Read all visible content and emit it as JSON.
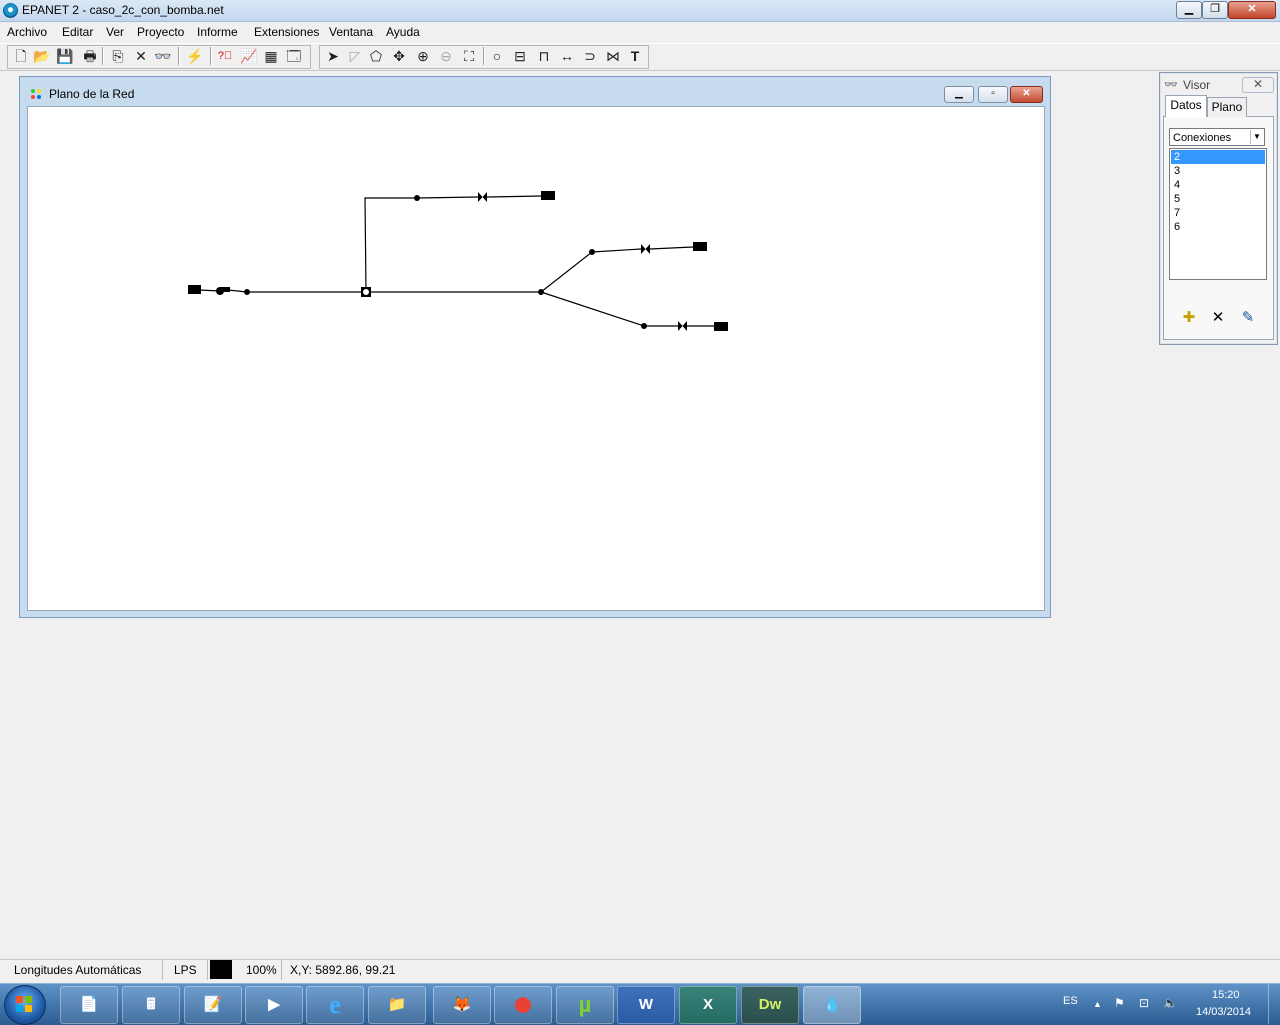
{
  "app": {
    "title": "EPANET 2 - caso_2c_con_bomba.net",
    "window_buttons": {
      "minimize": "▁",
      "maximize": "❐",
      "close": "✕"
    }
  },
  "menu": [
    "Archivo",
    "Editar",
    "Ver",
    "Proyecto",
    "Informe",
    "Extensiones",
    "Ventana",
    "Ayuda"
  ],
  "toolbar": {
    "icons": [
      "new-icon",
      "open-icon",
      "save-icon",
      "print-icon",
      "copy-icon",
      "delete-icon",
      "find-icon",
      "run-icon",
      "query-icon",
      "graph-icon",
      "table-icon",
      "options-icon",
      "select-icon",
      "select-vertex-icon",
      "select-region-icon",
      "pan-icon",
      "zoom-in-icon",
      "zoom-out-icon",
      "full-extent-icon",
      "add-junction-icon",
      "add-reservoir-icon",
      "add-tank-icon",
      "add-pipe-icon",
      "add-pump-icon",
      "add-valve-icon",
      "add-label-icon"
    ],
    "glyphs": {
      "new": "🗋",
      "open": "📂",
      "save": "💾",
      "print": "🖶",
      "copy": "⎘",
      "delete": "✕",
      "find": "👓",
      "run": "⚡",
      "query": "?⃞",
      "graph": "📈",
      "table": "▦",
      "options": "🗔",
      "select": "➤",
      "vertex": "◸",
      "region": "⬠",
      "pan": "✥",
      "zoomin": "⊕",
      "zoomout": "⊖",
      "extent": "⛶",
      "junction": "○",
      "reservoir": "⊟",
      "tank": "⊓",
      "pipe": "↔",
      "pump": "⊃",
      "valve": "⋈",
      "label": "T"
    }
  },
  "map_window": {
    "title": "Plano de la Red",
    "buttons": {
      "minimize": "▁",
      "maximize": "▫",
      "close": "✕"
    }
  },
  "visor": {
    "title": "Visor",
    "close": "✕",
    "tabs": [
      "Datos",
      "Plano"
    ],
    "selected_category": "Conexiones",
    "items": [
      "2",
      "3",
      "4",
      "5",
      "7",
      "6"
    ],
    "selected_item": "2",
    "buttons": {
      "add": "✚",
      "delete": "✕",
      "edit": "✎"
    }
  },
  "status": {
    "auto_length": "Longitudes Automáticas Off",
    "flow_units": "LPS",
    "zoom": "100%",
    "coords": "X,Y: 5892.86, 99.21"
  },
  "taskbar": {
    "apps": [
      "📄",
      "🖩",
      "📝",
      "▶",
      "e",
      "📁",
      "🦊",
      "⬤",
      "µ",
      "W",
      "X",
      "Dw",
      "💧"
    ],
    "app_names": [
      "file-explorer-app",
      "calculator-app",
      "notepad-app",
      "media-player-app",
      "internet-explorer-app",
      "folder-app",
      "firefox-app",
      "chrome-app",
      "utorrent-app",
      "word-app",
      "excel-app",
      "dreamweaver-app",
      "epanet-app"
    ],
    "language": "ES",
    "time": "15:20",
    "date": "14/03/2014",
    "tray": {
      "up": "▲",
      "flag": "⚑",
      "network": "⊡",
      "volume": "🔈"
    }
  }
}
